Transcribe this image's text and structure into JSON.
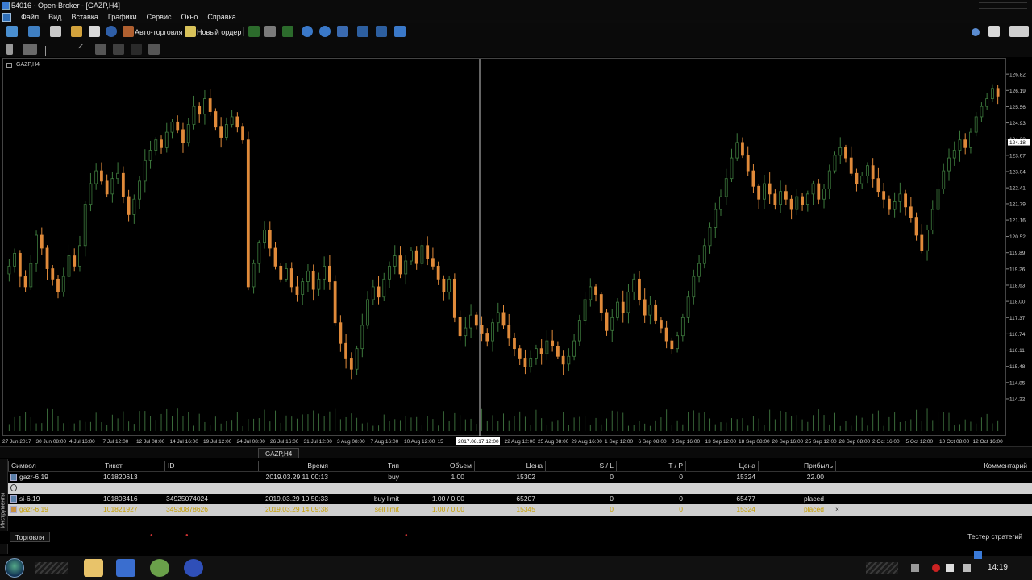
{
  "window": {
    "title": "54016 - Open-Broker - [GAZP,H4]"
  },
  "menu": {
    "items": [
      "Файл",
      "Вид",
      "Вставка",
      "Графики",
      "Сервис",
      "Окно",
      "Справка"
    ]
  },
  "toolbar": {
    "autotrade_label": "Авто-торговля",
    "new_order_label": "Новый ордер"
  },
  "chart": {
    "label": "GAZP,H4",
    "tab_label": "GAZP,H4",
    "crosshair": {
      "price": "124.18",
      "time": "2017.08.17 12:00"
    },
    "price_ticks": [
      "126.82",
      "126.19",
      "125.56",
      "124.93",
      "124.30",
      "123.67",
      "123.04",
      "122.41",
      "121.79",
      "121.16",
      "120.52",
      "119.89",
      "119.26",
      "118.63",
      "118.00",
      "117.37",
      "116.74",
      "116.11",
      "115.48",
      "114.85",
      "114.22"
    ],
    "time_ticks": [
      "27 Jun 2017",
      "30 Jun 08:00",
      "4 Jul 16:00",
      "7 Jul 12:00",
      "12 Jul 08:00",
      "14 Jul 16:00",
      "19 Jul 12:00",
      "24 Jul 08:00",
      "26 Jul 16:00",
      "31 Jul 12:00",
      "3 Aug 08:00",
      "7 Aug 16:00",
      "10 Aug 12:00",
      "15",
      "16:00",
      "22 Aug 12:00",
      "25 Aug 08:00",
      "29 Aug 16:00",
      "1 Sep 12:00",
      "6 Sep 08:00",
      "8 Sep 16:00",
      "13 Sep 12:00",
      "18 Sep 08:00",
      "20 Sep 16:00",
      "25 Sep 12:00",
      "28 Sep 08:00",
      "2 Oct 16:00",
      "5 Oct 12:00",
      "10 Oct 08:00",
      "12 Oct 16:00"
    ]
  },
  "terminal": {
    "side_label": "Инструменты",
    "columns": [
      "Символ",
      "Тикет",
      "ID",
      "Время",
      "Тип",
      "Объем",
      "Цена",
      "S / L",
      "T / P",
      "Цена",
      "Прибыль",
      "Комментарий"
    ],
    "rows": [
      {
        "symbol": "gazr-6.19",
        "ticket": "101820613",
        "id": "",
        "time": "2019.03.29 11:00:13",
        "type": "buy",
        "volume": "1.00",
        "price": "15302",
        "sl": "0",
        "tp": "0",
        "cur_price": "15324",
        "profit": "22.00",
        "comment": ""
      },
      {
        "symbol": "si-6.19",
        "ticket": "101803416",
        "id": "34925074024",
        "time": "2019.03.29 10:50:33",
        "type": "buy limit",
        "volume": "1.00 / 0.00",
        "price": "65207",
        "sl": "0",
        "tp": "0",
        "cur_price": "65477",
        "profit": "placed",
        "comment": ""
      },
      {
        "symbol": "gazr-6.19",
        "ticket": "101821927",
        "id": "34930878626",
        "time": "2019.03.29 14:09:38",
        "type": "sell limit",
        "volume": "1.00 / 0.00",
        "price": "15345",
        "sl": "0",
        "tp": "0",
        "cur_price": "15324",
        "profit": "placed",
        "comment": ""
      }
    ],
    "tabs": {
      "trade": "Торговля",
      "tester": "Тестер стратегий"
    }
  },
  "taskbar": {
    "clock": "14:19"
  },
  "colors": {
    "bull": "#3d7a3d",
    "bear": "#e08a3a",
    "crosshair": "#ffffff",
    "grid_text": "#cfcfcf"
  },
  "chart_data": {
    "type": "candlestick",
    "ylim": [
      114.0,
      127.2
    ],
    "closes": [
      119.4,
      119.9,
      119.0,
      118.6,
      119.5,
      120.6,
      120.1,
      119.3,
      118.9,
      118.4,
      119.0,
      119.8,
      119.4,
      120.2,
      121.8,
      122.6,
      123.1,
      122.7,
      122.2,
      122.8,
      123.0,
      122.1,
      121.4,
      122.0,
      122.7,
      123.5,
      123.9,
      124.3,
      124.0,
      124.6,
      125.0,
      124.7,
      124.2,
      124.9,
      125.6,
      125.3,
      125.9,
      125.4,
      124.8,
      124.4,
      124.9,
      125.2,
      124.8,
      124.3,
      118.6,
      119.5,
      120.3,
      120.8,
      120.1,
      119.4,
      118.9,
      119.3,
      118.6,
      118.3,
      118.8,
      119.2,
      118.5,
      118.9,
      119.4,
      118.8,
      117.2,
      116.4,
      115.8,
      115.4,
      116.2,
      117.1,
      118.1,
      118.6,
      118.2,
      118.9,
      119.4,
      119.8,
      119.1,
      119.6,
      120.0,
      119.5,
      120.2,
      119.7,
      119.4,
      118.9,
      118.4,
      118.9,
      117.4,
      116.7,
      117.0,
      117.5,
      117.1,
      116.8,
      116.5,
      117.2,
      117.6,
      117.1,
      116.6,
      116.2,
      115.8,
      115.5,
      115.8,
      116.2,
      116.0,
      116.5,
      116.3,
      115.9,
      115.6,
      115.9,
      116.5,
      117.3,
      118.1,
      118.6,
      118.3,
      117.6,
      116.9,
      117.4,
      118.0,
      117.6,
      118.4,
      118.9,
      118.1,
      117.5,
      117.9,
      117.3,
      117.0,
      116.5,
      116.2,
      116.7,
      117.4,
      118.2,
      119.0,
      119.5,
      120.2,
      120.9,
      121.6,
      122.1,
      122.8,
      123.6,
      124.2,
      123.7,
      123.1,
      122.5,
      122.0,
      122.6,
      122.2,
      121.8,
      122.3,
      122.0,
      121.6,
      122.1,
      121.8,
      122.2,
      122.6,
      122.0,
      122.4,
      123.1,
      123.7,
      124.0,
      123.6,
      123.0,
      122.6,
      122.9,
      123.3,
      122.8,
      122.3,
      122.0,
      121.6,
      121.9,
      122.2,
      121.7,
      121.3,
      120.6,
      120.0,
      120.8,
      121.6,
      122.4,
      123.1,
      123.6,
      123.9,
      124.3,
      124.0,
      124.6,
      125.2,
      125.6,
      125.9,
      126.3,
      126.0
    ]
  }
}
